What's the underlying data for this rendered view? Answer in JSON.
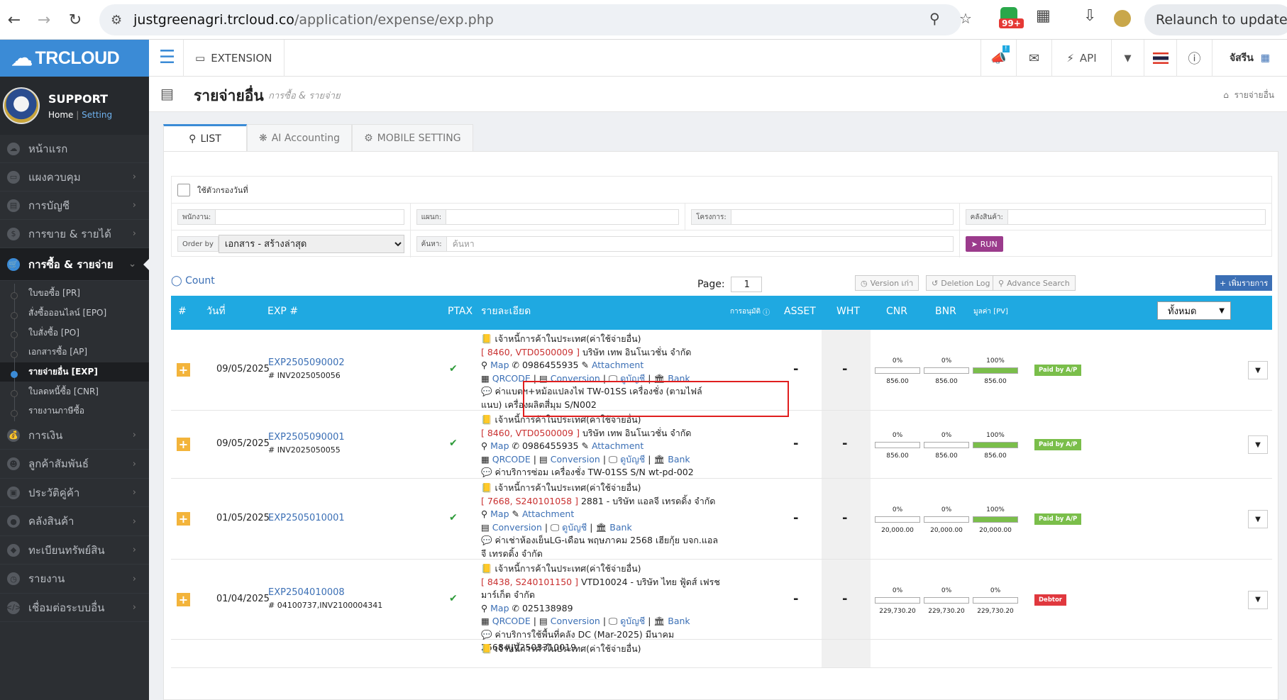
{
  "browser": {
    "url_host": "justgreenagri.trcloud.co",
    "url_path": "/application/expense/exp.php",
    "ext_badge": "99+",
    "relaunch_label": "Relaunch to update"
  },
  "sidebar": {
    "brand": "TRCLOUD",
    "user_name": "SUPPORT",
    "home_link": "Home",
    "setting_link": "Setting",
    "items_top": [
      {
        "label": "หน้าแรก"
      },
      {
        "label": "แผงควบคุม"
      },
      {
        "label": "การบัญชี"
      },
      {
        "label": "การขาย & รายได้"
      },
      {
        "label": "การซื้อ & รายจ่าย"
      }
    ],
    "sub_items": [
      {
        "label": "ใบขอซื้อ [PR]"
      },
      {
        "label": "สั่งซื้อออนไลน์ [EPO]"
      },
      {
        "label": "ใบสั่งซื้อ [PO]"
      },
      {
        "label": "เอกสารซื้อ [AP]"
      },
      {
        "label": "รายจ่ายอื่น [EXP]"
      },
      {
        "label": "ใบลดหนี้ซื้อ [CNR]"
      },
      {
        "label": "รายงานภาษีซื้อ"
      }
    ],
    "items_bottom": [
      {
        "label": "การเงิน"
      },
      {
        "label": "ลูกค้าสัมพันธ์"
      },
      {
        "label": "ประวัติคู่ค้า"
      },
      {
        "label": "คลังสินค้า"
      },
      {
        "label": "ทะเบียนทรัพย์สิน"
      },
      {
        "label": "รายงาน"
      },
      {
        "label": "เชื่อมต่อระบบอื่น"
      }
    ]
  },
  "topbar": {
    "extension_label": "EXTENSION",
    "notif_count": "!",
    "api_label": "API",
    "user_label": "จัสรีน"
  },
  "page": {
    "title": "รายจ่ายอื่น",
    "breadcrumb": "การซื้อ & รายจ่าย",
    "breadcrumb_right": "รายจ่ายอื่น"
  },
  "tabs": [
    {
      "label": "LIST"
    },
    {
      "label": "AI Accounting"
    },
    {
      "label": "MOBILE SETTING"
    }
  ],
  "filters": {
    "date_filter_label": "ใช้ตัวกรองวันที่",
    "employee_label": "พนักงาน:",
    "department_label": "แผนก:",
    "project_label": "โครงการ:",
    "warehouse_label": "คลังสินค้า:",
    "order_by_label": "Order by",
    "order_by_value": "เอกสาร - สร้างล่าสุด",
    "search_label": "ค้นหา:",
    "search_placeholder": "ค้นหา",
    "run_label": "RUN"
  },
  "toolbar": {
    "count_label": "Count",
    "page_label": "Page:",
    "page_value": "1",
    "version_label": "Version เก่า",
    "deletion_label": "Deletion Log",
    "advance_label": "Advance Search",
    "add_label": "+ เพิ่มรายการ"
  },
  "table": {
    "headers": {
      "num": "#",
      "date": "วันที่",
      "exp": "EXP #",
      "ptax": "PTAX",
      "detail": "รายละเอียด",
      "approve": "การอนุมัติ",
      "asset": "ASSET",
      "wht": "WHT",
      "cnr": "CNR",
      "bnr": "BNR",
      "pv": "มูลค่า [PV]",
      "filter": "ทั้งหมด"
    },
    "rows": [
      {
        "date": "09/05/2025",
        "exp": "EXP2505090002",
        "inv": "INV2025050056",
        "category": "เจ้าหนี้การค้าในประเทศ(ค่าใช้จ่ายอื่น)",
        "code": "[ 8460, VTD0500009 ]",
        "company": "บริษัท เทพ อินโนเวชั่น จำกัด",
        "line3": [
          "Map",
          "0986455935",
          "Attachment"
        ],
        "line4": [
          "QRCODE",
          "Conversion",
          "ดูบัญชี",
          "Bank"
        ],
        "note": "ค่าแบตฯ+หม้อแปลงไฟ TW-01SS เครื่องชั่ง (ตามไฟล์แนบ) เครื่องผลิตสี่มุม S/N002",
        "asset": "-",
        "wht": "-",
        "cnr_pct": "0%",
        "cnr_val": "856.00",
        "cnr_fill": 0,
        "bnr_pct": "0%",
        "bnr_val": "856.00",
        "bnr_fill": 0,
        "pv_pct": "100%",
        "pv_val": "856.00",
        "pv_fill": 100,
        "status": "Paid by A/P",
        "status_color": "#7abe4a"
      },
      {
        "date": "09/05/2025",
        "exp": "EXP2505090001",
        "inv": "INV2025050055",
        "category": "เจ้าหนี้การค้าในประเทศ(ค่าใช้จ่ายอื่น)",
        "code": "[ 8460, VTD0500009 ]",
        "company": "บริษัท เทพ อินโนเวชั่น จำกัด",
        "line3": [
          "Map",
          "0986455935",
          "Attachment"
        ],
        "line4": [
          "QRCODE",
          "Conversion",
          "ดูบัญชี",
          "Bank"
        ],
        "note": "ค่าบริการซ่อม เครื่องชั่ง TW-01SS S/N wt-pd-002",
        "asset": "-",
        "wht": "-",
        "cnr_pct": "0%",
        "cnr_val": "856.00",
        "cnr_fill": 0,
        "bnr_pct": "0%",
        "bnr_val": "856.00",
        "bnr_fill": 0,
        "pv_pct": "100%",
        "pv_val": "856.00",
        "pv_fill": 100,
        "status": "Paid by A/P",
        "status_color": "#7abe4a"
      },
      {
        "date": "01/05/2025",
        "exp": "EXP2505010001",
        "inv": "",
        "category": "เจ้าหนี้การค้าในประเทศ(ค่าใช้จ่ายอื่น)",
        "code": "[ 7668, S240101058 ]",
        "company": "2881 - บริษัท แอลจี เทรดดิ้ง จำกัด",
        "line3": [
          "Map",
          "Attachment"
        ],
        "line4": [
          "Conversion",
          "ดูบัญชี",
          "Bank"
        ],
        "note": "ค่าเช่าห้องเย็นLG-เดือน พฤษภาคม 2568 เฮียกุ้ย บจก.แอลจี เทรดดิ้ง จำกัด",
        "asset": "-",
        "wht": "-",
        "cnr_pct": "0%",
        "cnr_val": "20,000.00",
        "cnr_fill": 0,
        "bnr_pct": "0%",
        "bnr_val": "20,000.00",
        "bnr_fill": 0,
        "pv_pct": "100%",
        "pv_val": "20,000.00",
        "pv_fill": 100,
        "status": "Paid by A/P",
        "status_color": "#7abe4a"
      },
      {
        "date": "01/04/2025",
        "exp": "EXP2504010008",
        "inv": "04100737,INV2100004341",
        "category": "เจ้าหนี้การค้าในประเทศ(ค่าใช้จ่ายอื่น)",
        "code": "[ 8438, S240101150 ]",
        "company": "VTD10024 - บริษัท ไทย ฟู้ดส์ เฟรช มาร์เก็ต จำกัด",
        "line3": [
          "Map",
          "025138989"
        ],
        "line4": [
          "QRCODE",
          "Conversion",
          "ดูบัญชี",
          "Bank"
        ],
        "note": "ค่าบริการใช้พื้นที่คลัง DC (Mar-2025) มีนาคม 2568#JV2503310019",
        "asset": "-",
        "wht": "-",
        "cnr_pct": "0%",
        "cnr_val": "229,730.20",
        "cnr_fill": 0,
        "bnr_pct": "0%",
        "bnr_val": "229,730.20",
        "bnr_fill": 0,
        "pv_pct": "0%",
        "pv_val": "229,730.20",
        "pv_fill": 0,
        "status": "Debtor",
        "status_color": "#e0383e"
      },
      {
        "category": "เจ้าหนี้การค้าในประเทศ(ค่าใช้จ่ายอื่น)"
      }
    ]
  }
}
